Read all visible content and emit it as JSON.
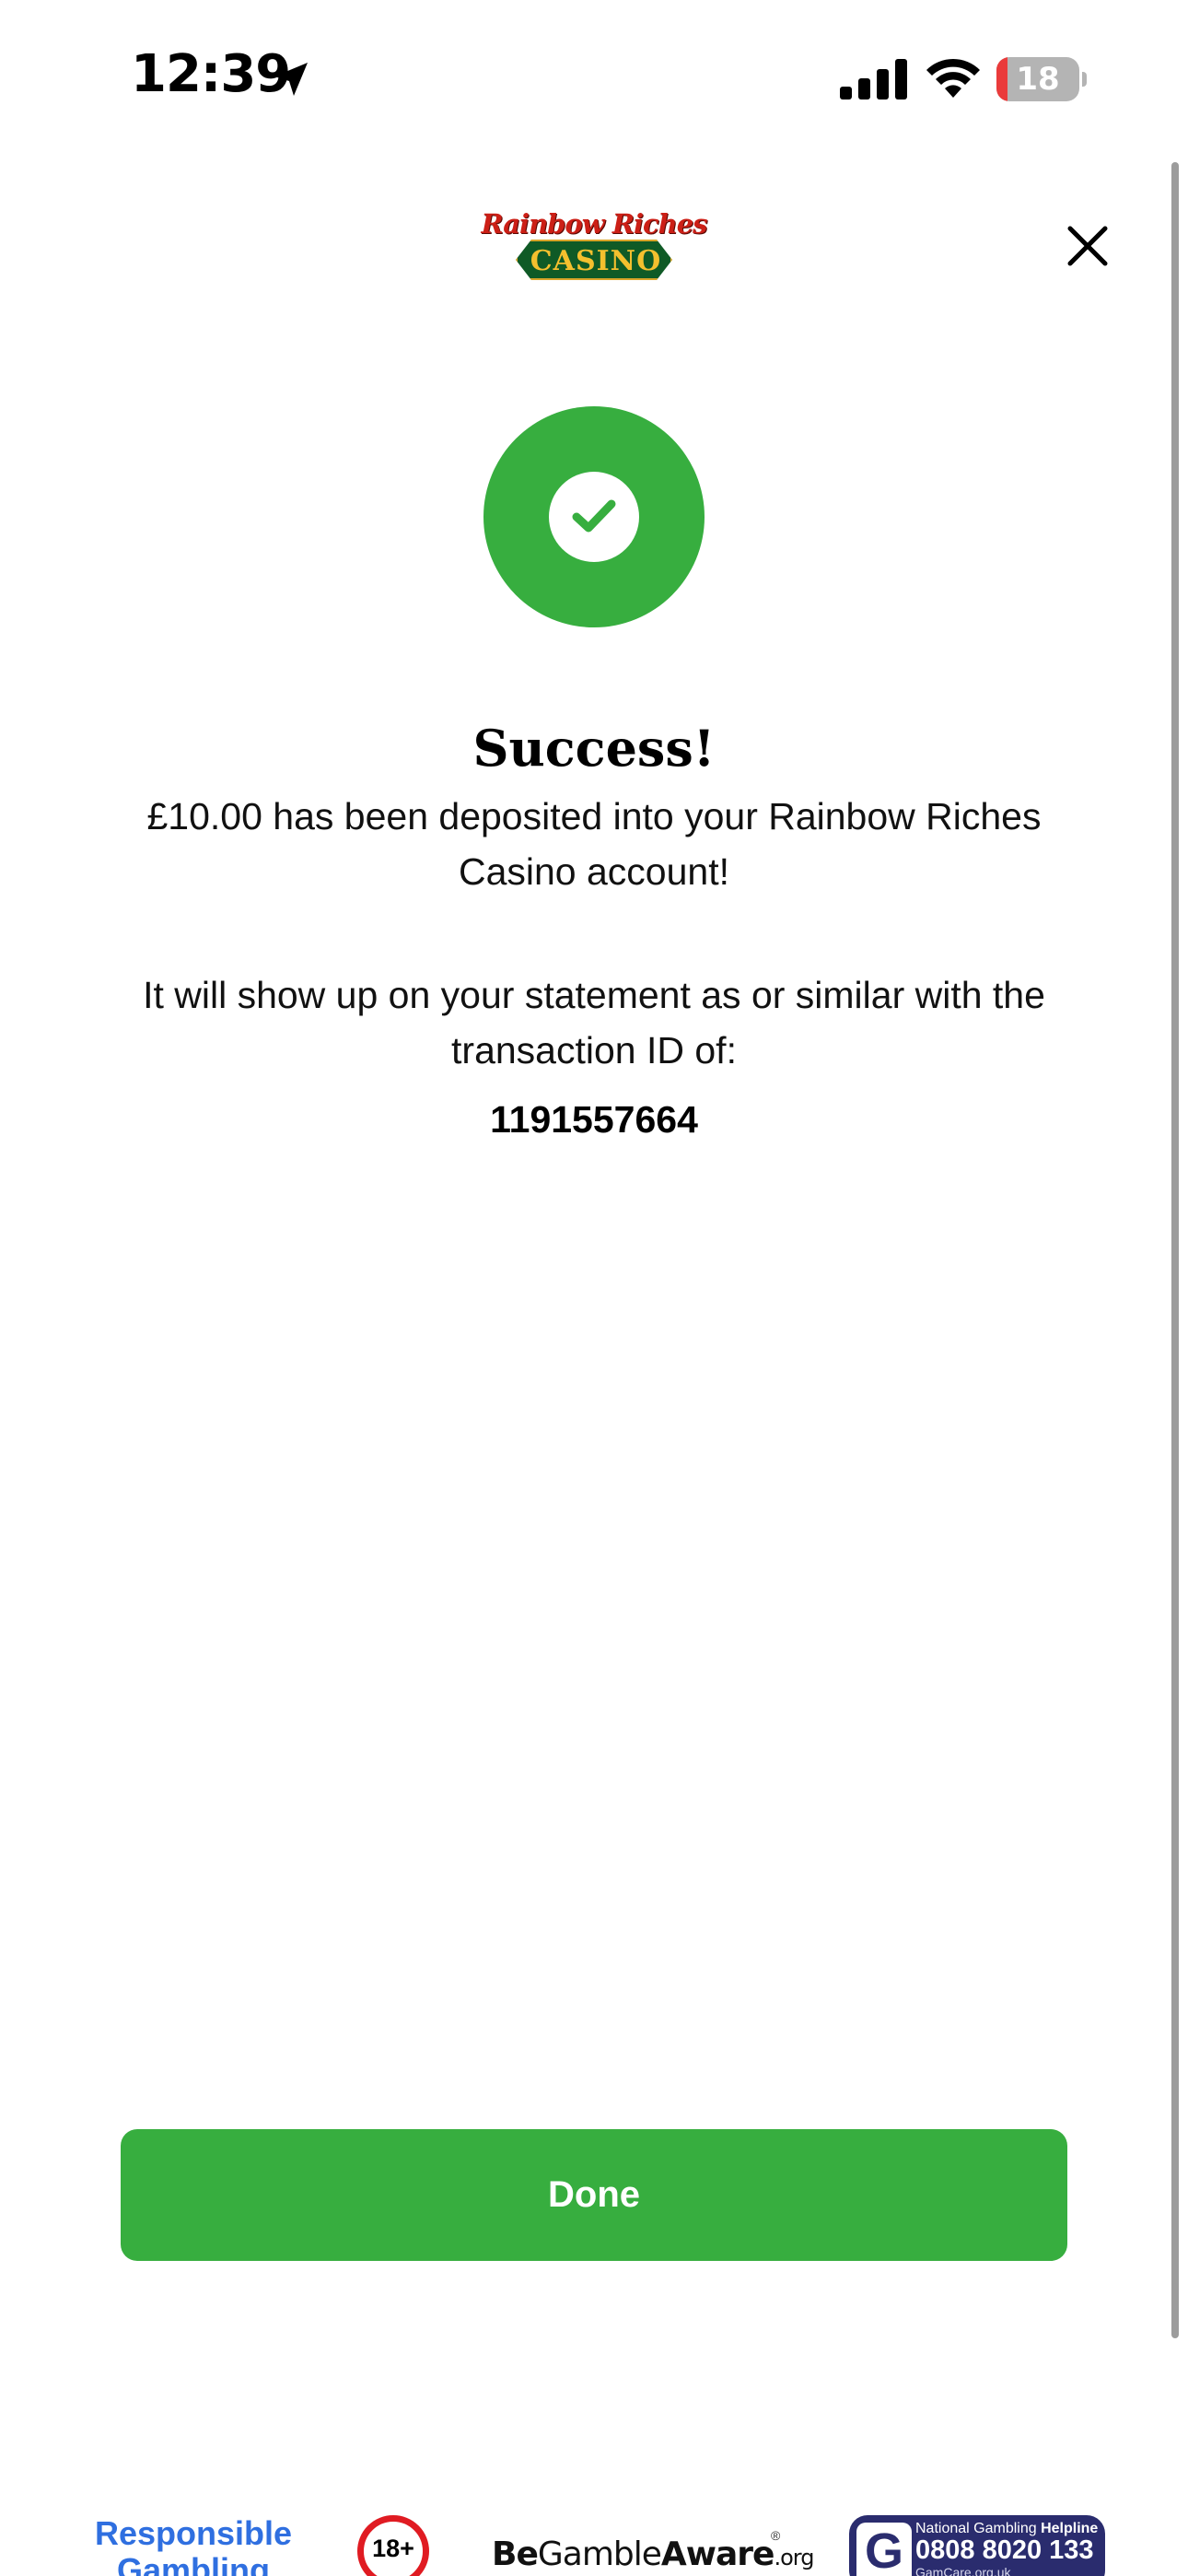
{
  "status_bar": {
    "time": "12:39",
    "battery_level": "18",
    "battery_percent": 18,
    "icons": [
      "location-arrow-icon",
      "cellular-signal-icon",
      "wifi-icon",
      "battery-icon"
    ]
  },
  "header": {
    "logo_line1": "Rainbow Riches",
    "logo_line2": "CASINO",
    "close_icon": "close-icon"
  },
  "success": {
    "icon": "checkmark-icon",
    "title": "Success!",
    "message": "£10.00 has been deposited into your Rainbow Riches Casino account!",
    "statement_text": "It will show up on your statement as or similar with the transaction ID of:",
    "transaction_id": "1191557664"
  },
  "actions": {
    "done_label": "Done"
  },
  "footer": {
    "responsible_gambling_line1": "Responsible",
    "responsible_gambling_line2": "Gambling",
    "age_badge": "18+",
    "bga_be": "Be",
    "bga_gamble": "Gamble",
    "bga_aware": "Aware",
    "bga_org": ".org",
    "bga_reg": "®",
    "helpline_prefix": "National Gambling",
    "helpline_suffix": "Helpline",
    "helpline_number": "0808 8020 133",
    "helpline_site": "GamCare.org.uk",
    "helpline_logo_letter": "G"
  },
  "colors": {
    "accent_green": "#37ae3f",
    "link_blue": "#2f6fe0",
    "badge_red": "#e01b22",
    "helpline_navy": "#2a2c6e"
  }
}
